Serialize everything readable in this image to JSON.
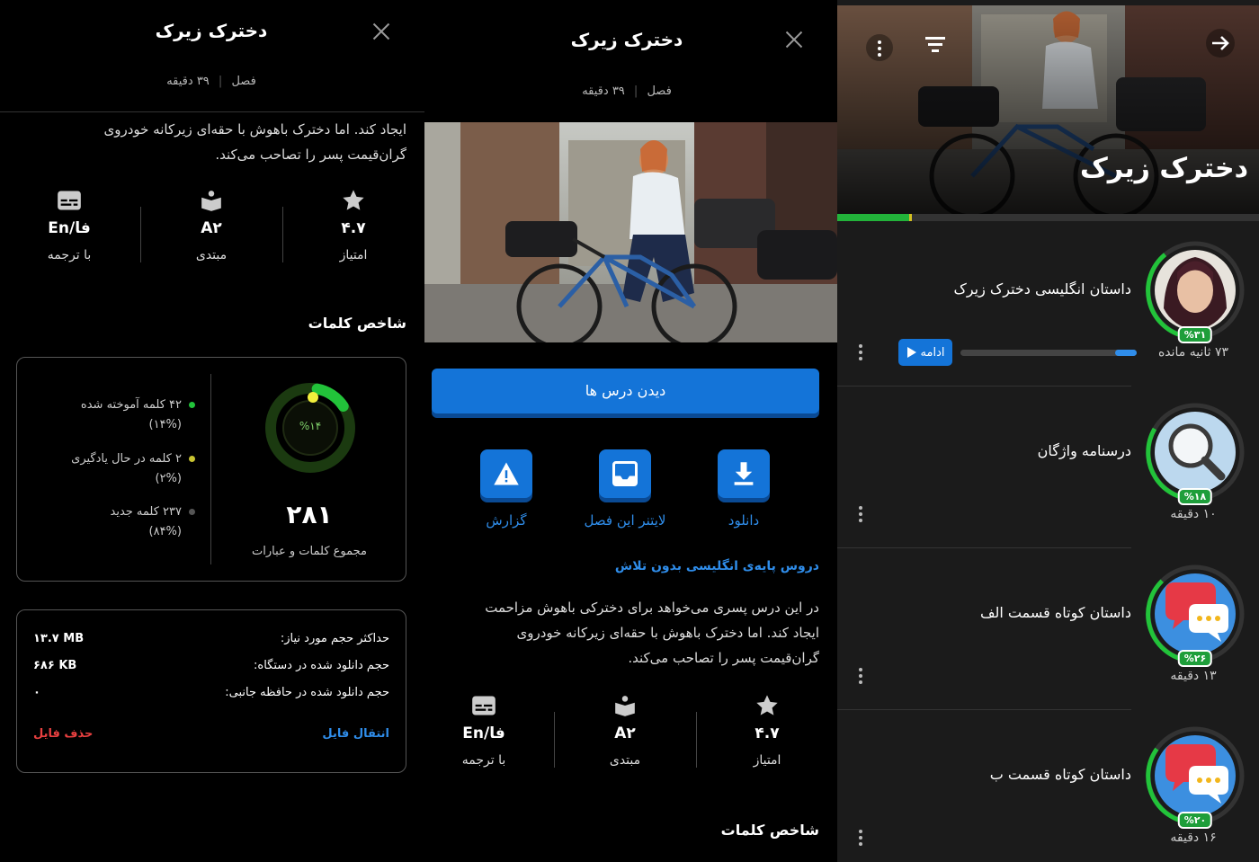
{
  "left_panel": {
    "title": "دخترک زیرک",
    "meta_part": "فصل",
    "meta_duration": "۳۹ دقیقه",
    "desc_line1": "ایجاد کند. اما دخترک باهوش با حقه‌ای زیرکانه خودروی",
    "desc_line2": "گران‌قیمت پسر را تصاحب می‌کند.",
    "stats": [
      {
        "icon": "star-icon",
        "value": "۴.۷",
        "label": "امتیاز"
      },
      {
        "icon": "book-icon",
        "value": "A۲",
        "label": "مبتدی"
      },
      {
        "icon": "subtitles-icon",
        "value": "En/فا",
        "label": "با ترجمه"
      }
    ],
    "index_title": "شاخص کلمات",
    "ring_percent": "%۱۴",
    "total_count": "۲۸۱",
    "total_label": "مجموع کلمات و عبارات",
    "legend": [
      {
        "line1": "۴۲ کلمه آموخته شده",
        "line2": "(۱۴%)",
        "color": "#22c33a"
      },
      {
        "line1": "۲ کلمه در حال یادگیری",
        "line2": "(۲%)",
        "color": "#c9c431"
      },
      {
        "line1": "۲۳۷ کلمه جدید",
        "line2": "(۸۴%)",
        "color": "#555555"
      }
    ],
    "storage": [
      {
        "label": "حداکثر حجم مورد نیاز:",
        "value": "۱۳.۷ MB"
      },
      {
        "label": "حجم دانلود شده در دستگاه:",
        "value": "۶۸۶ KB"
      },
      {
        "label": "حجم دانلود شده در حافظه جانبی:",
        "value": "۰"
      }
    ],
    "move_file": "انتقال فایل",
    "delete_file": "حذف فایل",
    "colors": {
      "green": "#22c33a",
      "yellow": "#c9c431",
      "blue_link": "#2f8dea",
      "red": "#e84040"
    }
  },
  "middle_panel": {
    "title": "دخترک زیرک",
    "meta_part": "فصل",
    "meta_duration": "۳۹ دقیقه",
    "view_lessons": "دیدن درس ها",
    "actions": [
      {
        "icon": "download-icon",
        "label": "دانلود"
      },
      {
        "icon": "inbox-icon",
        "label": "لایتنر این فصل"
      },
      {
        "icon": "warning-icon",
        "label": "گزارش"
      }
    ],
    "course_link": "دروس پایه‌ی انگلیسی بدون تلاش",
    "desc_line1": "در این درس پسری می‌خواهد برای دخترکی باهوش مزاحمت",
    "desc_line2": "ایجاد کند. اما دخترک باهوش با حقه‌ای زیرکانه خودروی",
    "desc_line3": "گران‌قیمت پسر را تصاحب می‌کند.",
    "stats": [
      {
        "icon": "star-icon",
        "value": "۴.۷",
        "label": "امتیاز"
      },
      {
        "icon": "book-icon",
        "value": "A۲",
        "label": "مبتدی"
      },
      {
        "icon": "subtitles-icon",
        "value": "En/فا",
        "label": "با ترجمه"
      }
    ],
    "index_title": "شاخص کلمات",
    "accent": "#1474d8"
  },
  "right_panel": {
    "hero_title": "دخترک زیرک",
    "progress": 0.17,
    "lessons": [
      {
        "title": "داستان انگلیسی دخترک زیرک",
        "subtitle": "۷۳ ثانیه مانده",
        "pct": "%۳۱",
        "kind": "portrait",
        "continue": "ادامه",
        "bar": 0.12
      },
      {
        "title": "درسنامه واژگان",
        "subtitle": "۱۰ دقیقه",
        "pct": "%۱۸",
        "kind": "magnifier"
      },
      {
        "title": "داستان کوتاه قسمت الف",
        "subtitle": "۱۳ دقیقه",
        "pct": "%۲۶",
        "kind": "chat"
      },
      {
        "title": "داستان کوتاه قسمت ب",
        "subtitle": "۱۶ دقیقه",
        "pct": "%۲۰",
        "kind": "chat"
      }
    ]
  }
}
